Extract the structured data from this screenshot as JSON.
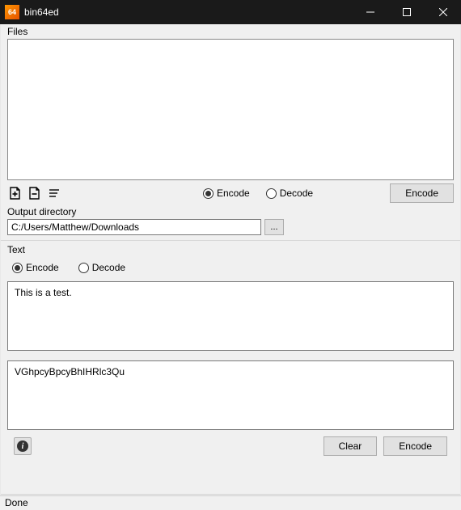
{
  "window": {
    "title": "bin64ed",
    "icon_text": "64"
  },
  "files": {
    "label": "Files"
  },
  "fileMode": {
    "encode": "Encode",
    "decode": "Decode"
  },
  "fileActionButton": "Encode",
  "outputDir": {
    "label": "Output directory",
    "value": "C:/Users/Matthew/Downloads",
    "browse": "..."
  },
  "text": {
    "label": "Text",
    "encode": "Encode",
    "decode": "Decode",
    "input": "This is a test.",
    "output": "VGhpcyBpcyBhIHRlc3Qu"
  },
  "buttons": {
    "clear": "Clear",
    "encode": "Encode"
  },
  "status": "Done"
}
